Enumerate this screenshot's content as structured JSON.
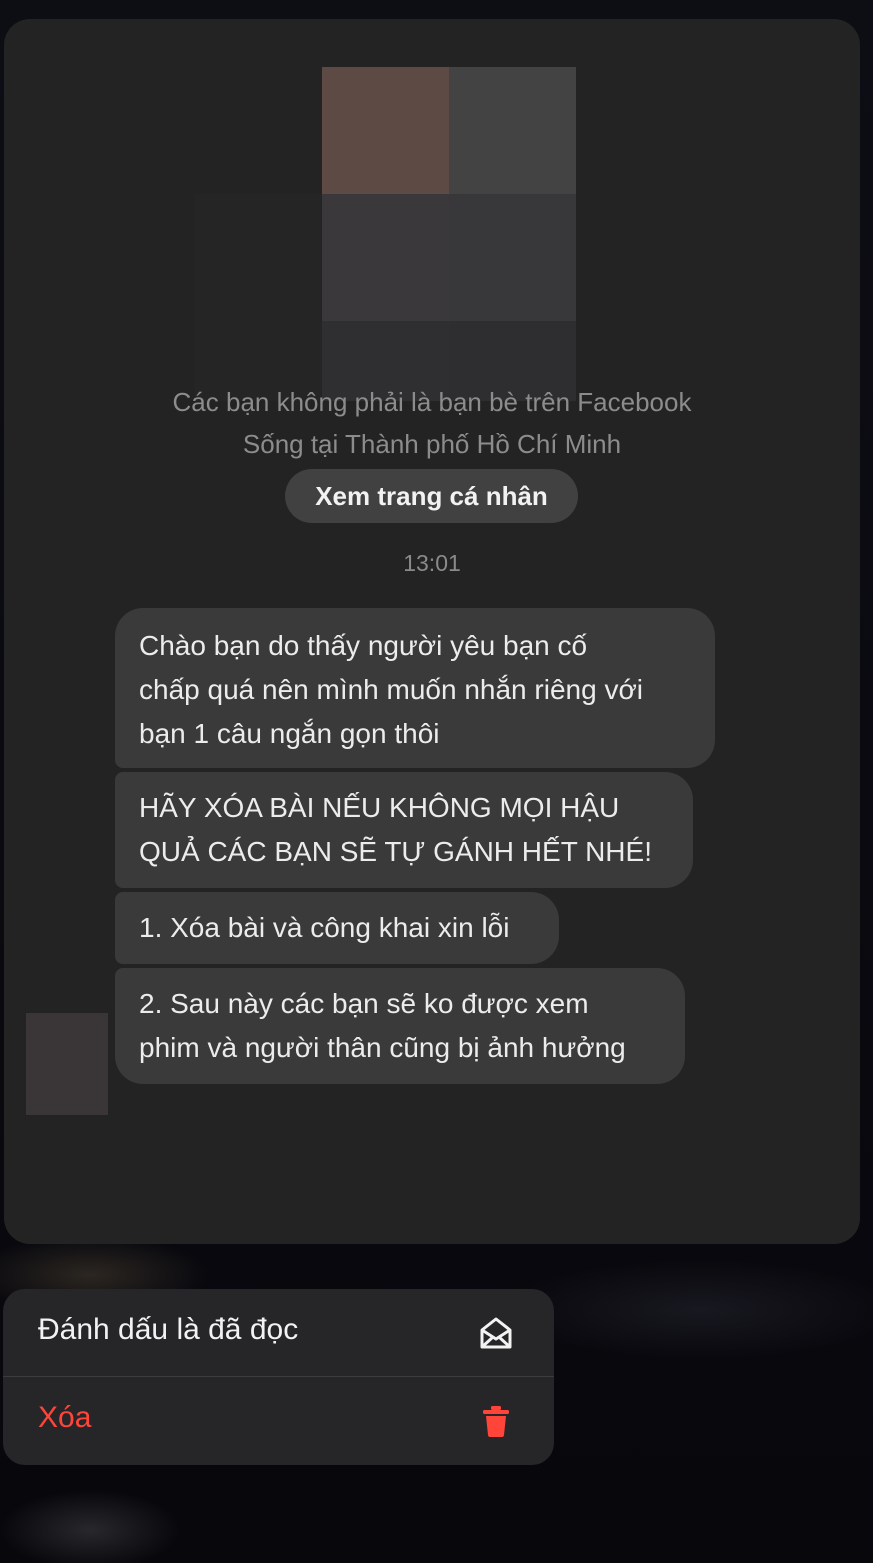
{
  "conversation": {
    "info_line_1": "Các bạn không phải là bạn bè trên Facebook",
    "info_line_2": "Sống tại Thành phố Hồ Chí Minh",
    "view_profile_label": "Xem trang cá nhân",
    "timestamp": "13:01",
    "messages": [
      {
        "lines": [
          "Chào bạn do thấy người yêu bạn cố",
          "chấp quá nên mình muốn nhắn riêng với",
          "bạn 1 câu ngắn gọn thôi"
        ]
      },
      {
        "lines": [
          "HÃY XÓA BÀI NẾU KHÔNG MỌI HẬU",
          "QUẢ CÁC BẠN SẼ TỰ GÁNH HẾT NHÉ!"
        ]
      },
      {
        "lines": [
          "1. Xóa bài và công khai xin lỗi"
        ]
      },
      {
        "lines": [
          "2. Sau này các bạn sẽ ko được xem",
          "phim và người thân cũng bị ảnh hưởng"
        ]
      }
    ]
  },
  "context_menu": {
    "items": [
      {
        "label": "Đánh dấu là đã đọc",
        "icon": "envelope-open-icon"
      },
      {
        "label": "Xóa",
        "icon": "trash-icon",
        "color": "#ff453a"
      }
    ]
  }
}
